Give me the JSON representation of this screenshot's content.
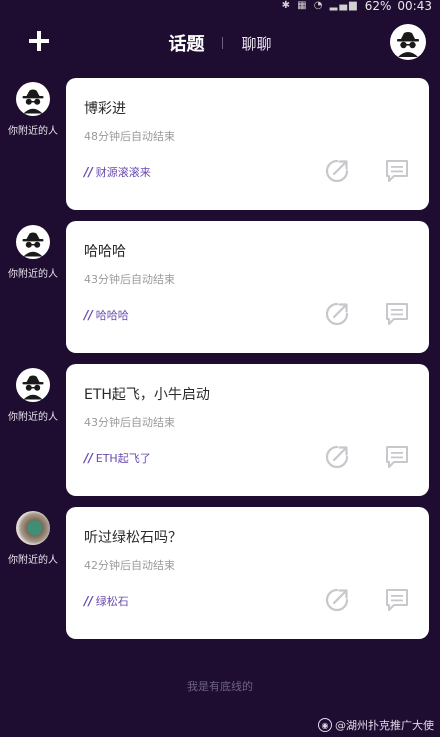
{
  "status_bar": {
    "battery": "62%",
    "time": "00:43"
  },
  "header": {
    "tabs": [
      {
        "label": "话题",
        "active": true
      },
      {
        "label": "聊聊",
        "active": false
      }
    ],
    "add_icon": "plus-icon",
    "avatar_icon": "incognito-avatar-icon"
  },
  "posts": [
    {
      "author": "你附近的人",
      "avatar": "incognito-avatar-icon",
      "title": "博彩进",
      "meta": "48分钟后自动结束",
      "tag": "财源滚滚来"
    },
    {
      "author": "你附近的人",
      "avatar": "incognito-avatar-icon",
      "title": "哈哈哈",
      "meta": "43分钟后自动结束",
      "tag": "哈哈哈"
    },
    {
      "author": "你附近的人",
      "avatar": "incognito-avatar-icon",
      "title": "ETH起飞，小牛启动",
      "meta": "43分钟后自动结束",
      "tag": "ETH起飞了"
    },
    {
      "author": "你附近的人",
      "avatar": "turquoise-photo-avatar",
      "title": "听过绿松石吗？",
      "meta": "42分钟后自动结束",
      "tag": "绿松石"
    }
  ],
  "footer": {
    "text": "我是有底线的"
  },
  "watermark": {
    "text": "@湖州扑克推广大使"
  },
  "colors": {
    "background": "#1f0d31",
    "card": "#ffffff",
    "tag": "#6a4ab0",
    "action_icon": "#c8c8cc"
  }
}
